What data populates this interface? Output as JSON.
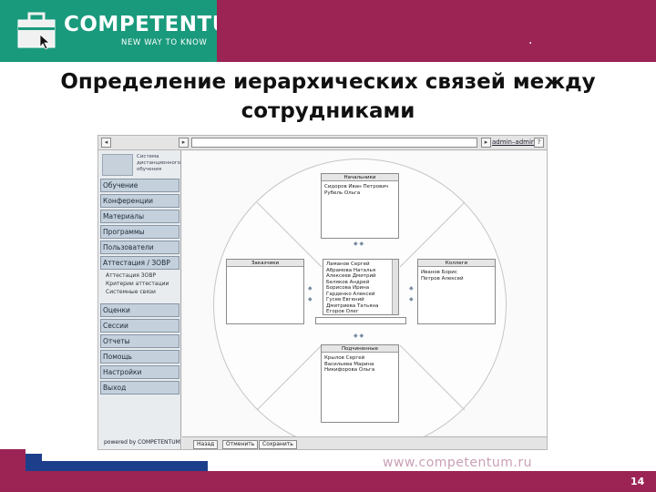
{
  "header": {
    "logo_name": "COMPETENTUM",
    "logo_slogan": "NEW WAY TO KNOW",
    "top_dot": "."
  },
  "slide": {
    "title_line1": "Определение иерархических связей между",
    "title_line2": "сотрудниками"
  },
  "app": {
    "toolbar": {
      "user_link": "admin–admin"
    },
    "sidebar": {
      "logo_text": [
        "Система",
        "дистанционного",
        "обучения"
      ],
      "items": [
        "Обучение",
        "Конференции",
        "Материалы",
        "Программы",
        "Пользователи",
        "Аттестация / ЗОВР",
        "Оценки",
        "Сессии",
        "Отчеты",
        "Помощь",
        "Настройки",
        "Выход"
      ],
      "sub_items": [
        "Аттестация ЗОВР",
        "Критерии аттестации",
        "Системные связи"
      ],
      "footer": "powered by COMPETENTUM"
    },
    "panels": {
      "top": {
        "title": "Начальники",
        "lines": [
          "Сидоров Иван Петрович",
          "Рубель Ольга"
        ]
      },
      "left": {
        "title": "Заказчики",
        "lines": []
      },
      "right": {
        "title": "Коллеги",
        "lines": [
          "Иванов Борис",
          "Петров Алексей"
        ]
      },
      "bottom": {
        "title": "Подчиненные",
        "lines": [
          "Крылов Сергей",
          "Васильева Марина",
          "Никифорова Ольга"
        ]
      },
      "center": {
        "lines": [
          "Ламанов Сергей",
          "Абрамова Наталья",
          "Алексеев Дмитрий",
          "Беляков Андрей",
          "Борисова Ирина",
          "Гарденко Алексей",
          "Гусев Евгений",
          "Дмитриева Татьяна",
          "Егоров Олег"
        ]
      }
    },
    "bottom_buttons": [
      "Назад",
      "Отменить",
      "Сохранить"
    ]
  },
  "footer": {
    "url": "www.competentum.ru",
    "page_number": "14"
  },
  "colors": {
    "brand_teal": "#1a9a7c",
    "brand_magenta": "#9b2455",
    "brand_blue": "#1d3e8a"
  }
}
